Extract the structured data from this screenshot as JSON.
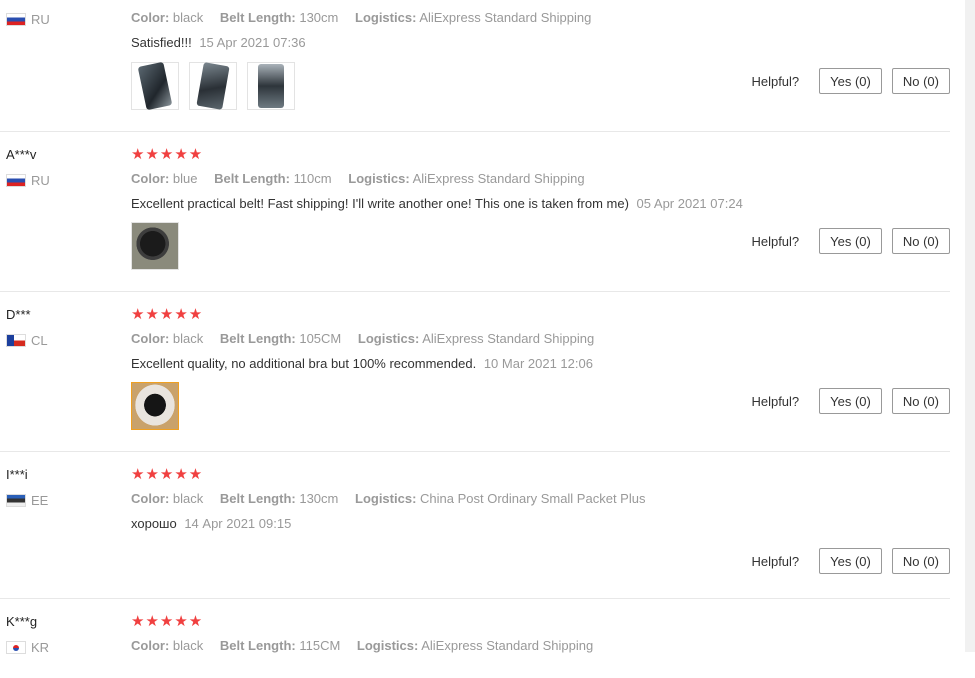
{
  "labels": {
    "color": "Color:",
    "belt_length": "Belt Length:",
    "logistics": "Logistics:",
    "helpful": "Helpful?"
  },
  "reviews": [
    {
      "user": "",
      "country": "RU",
      "flag": "flag-ru",
      "stars": "★★★★★",
      "color": "black",
      "belt_length": "130cm",
      "logistics": "AliExpress Standard Shipping",
      "comment": "Satisfied!!!",
      "date": "15 Apr 2021 07:36",
      "yes": "Yes (0)",
      "no": "No (0)",
      "images": [
        "belt-photo",
        "belt-photo",
        "belt-photo"
      ]
    },
    {
      "user": "A***v",
      "country": "RU",
      "flag": "flag-ru",
      "stars": "★★★★★",
      "color": "blue",
      "belt_length": "110cm",
      "logistics": "AliExpress Standard Shipping",
      "comment": "Excellent practical belt! Fast shipping! I'll write another one! This one is taken from me)",
      "date": "05 Apr 2021 07:24",
      "yes": "Yes (0)",
      "no": "No (0)",
      "images": [
        "belt-photo"
      ]
    },
    {
      "user": "D***",
      "country": "CL",
      "flag": "flag-cl",
      "stars": "★★★★★",
      "color": "black",
      "belt_length": "105CM",
      "logistics": "AliExpress Standard Shipping",
      "comment": "Excellent quality, no additional bra but 100% recommended.",
      "date": "10 Mar 2021 12:06",
      "yes": "Yes (0)",
      "no": "No (0)",
      "images": [
        "belt-photo"
      ]
    },
    {
      "user": "I***i",
      "country": "EE",
      "flag": "flag-ee",
      "stars": "★★★★★",
      "color": "black",
      "belt_length": "130cm",
      "logistics": "China Post Ordinary Small Packet Plus",
      "comment": "хорошо",
      "date": "14 Apr 2021 09:15",
      "yes": "Yes (0)",
      "no": "No (0)",
      "images": []
    },
    {
      "user": "K***g",
      "country": "KR",
      "flag": "flag-kr",
      "stars": "★★★★★",
      "color": "black",
      "belt_length": "115CM",
      "logistics": "AliExpress Standard Shipping"
    }
  ]
}
